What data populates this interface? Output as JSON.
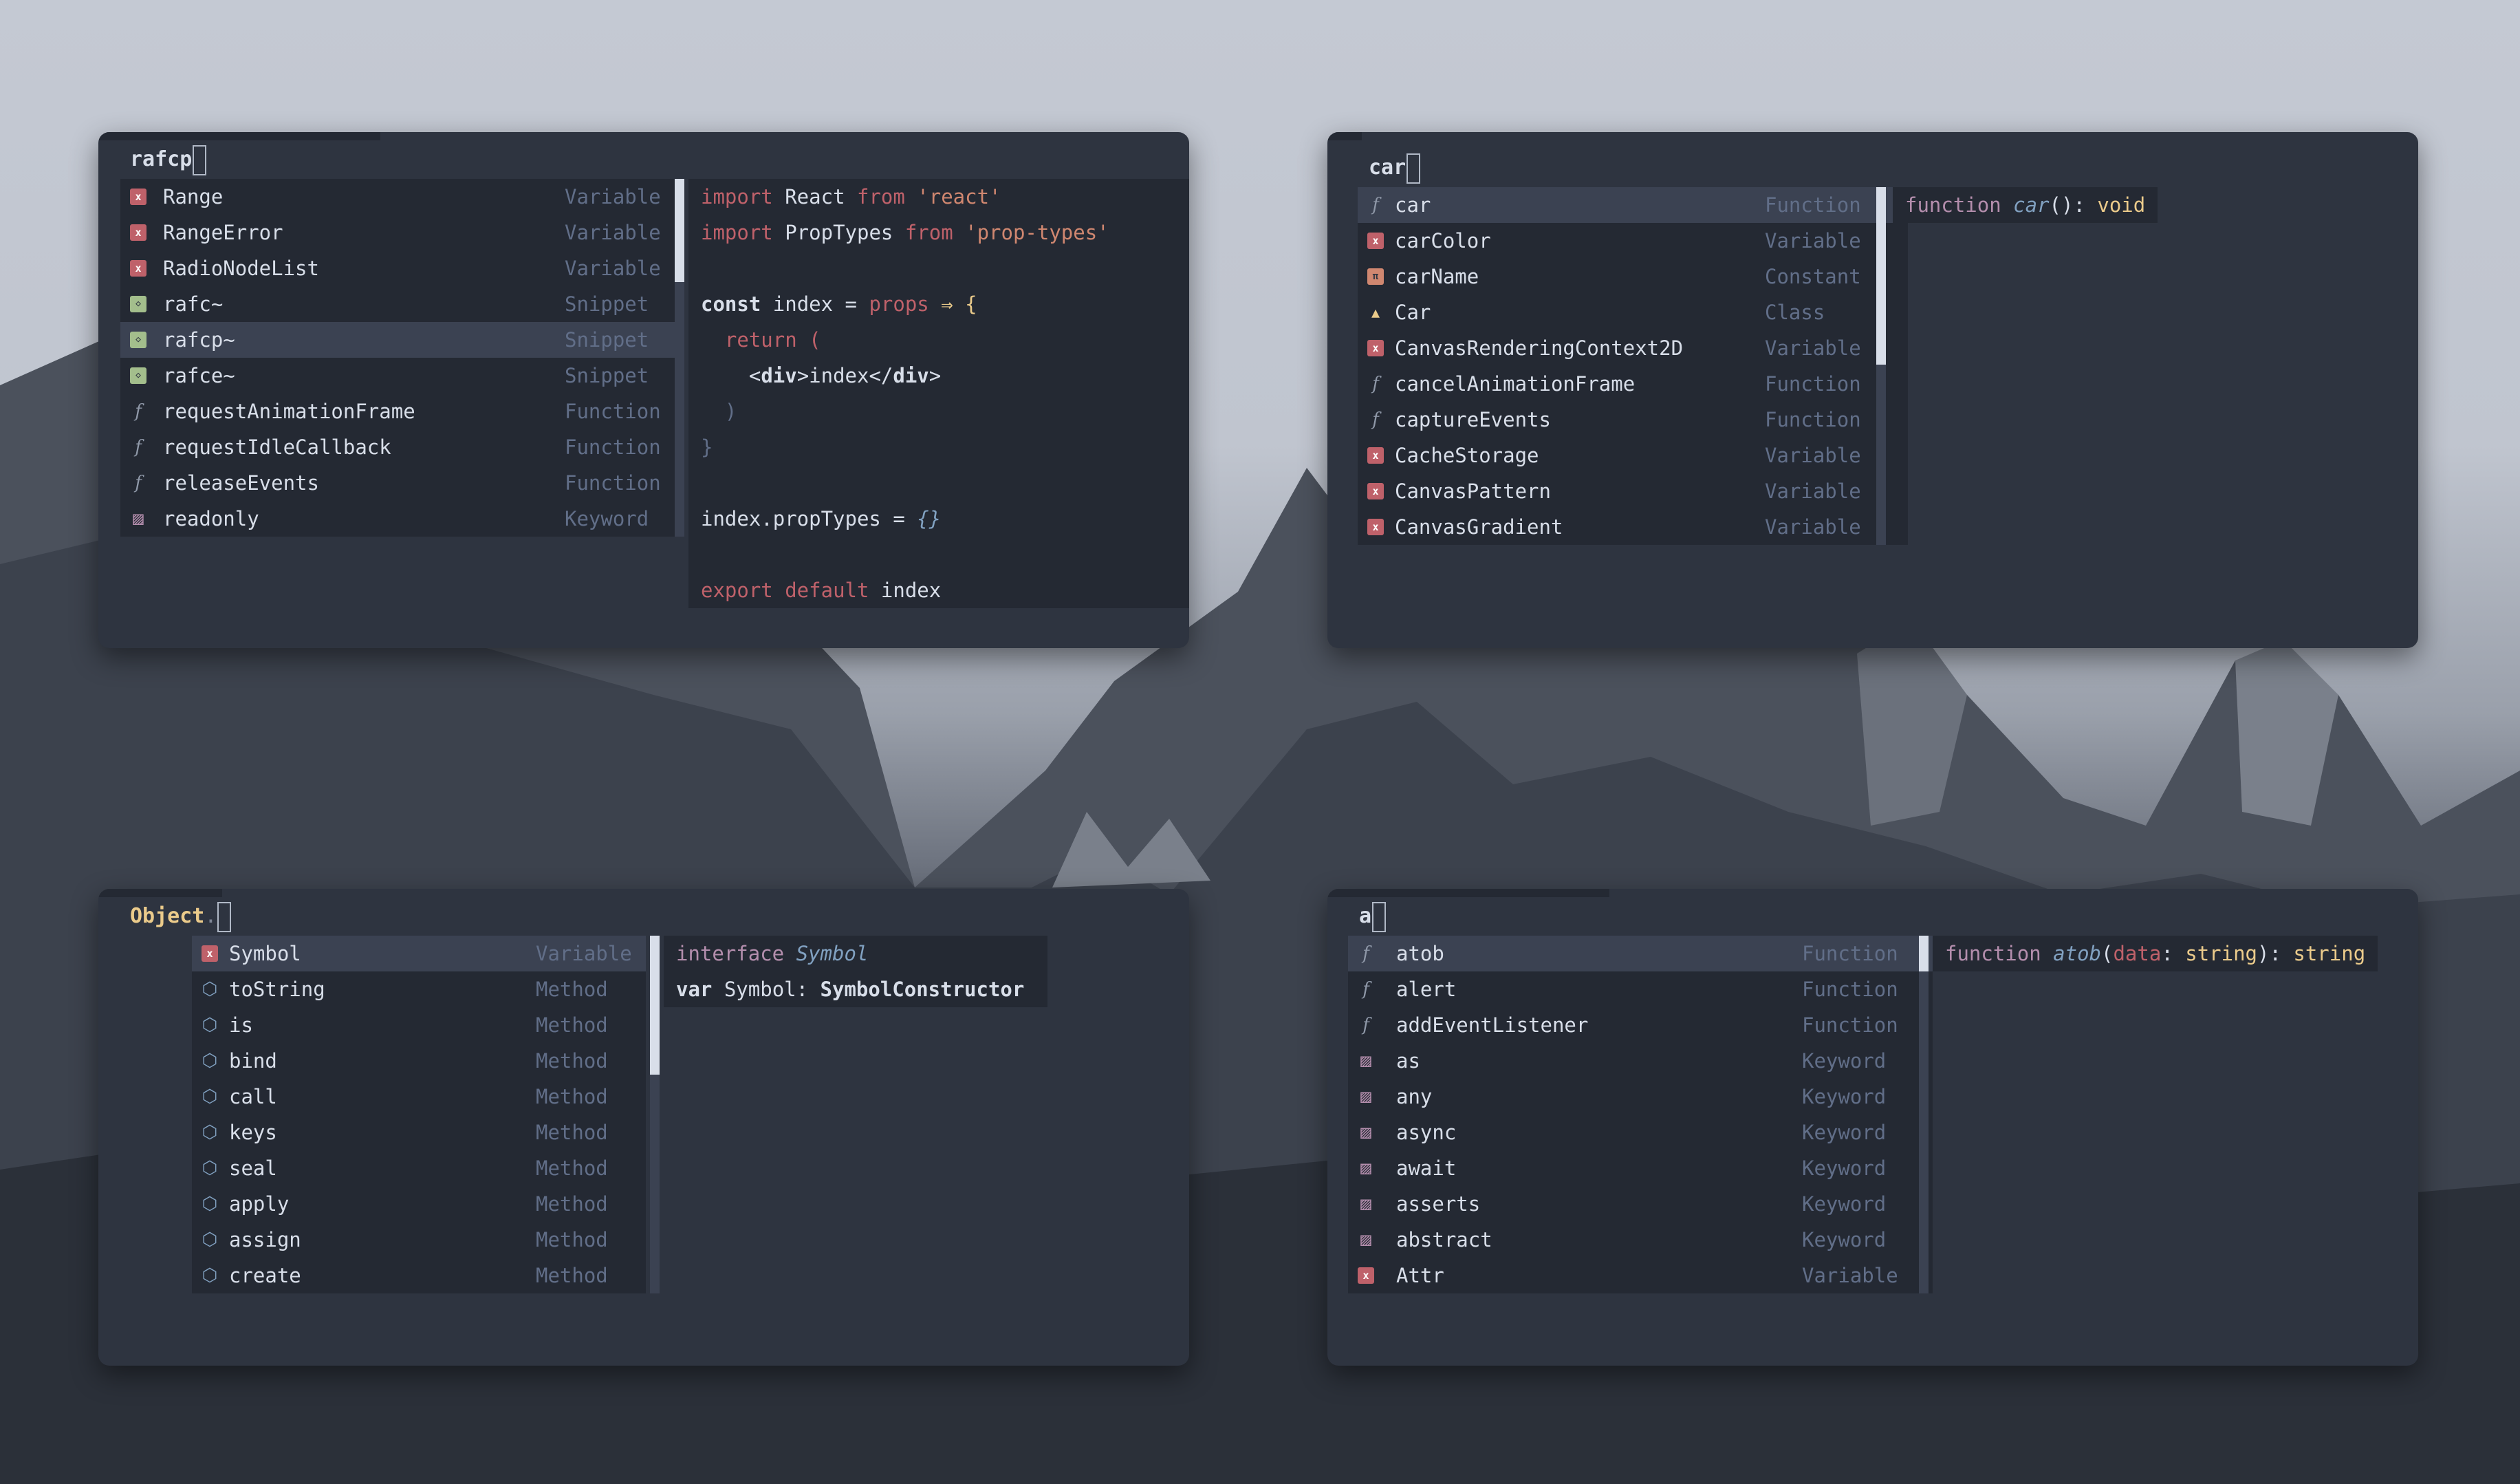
{
  "panels": {
    "p1": {
      "prompt": "rafcp",
      "items": [
        {
          "icon": "variable-icon",
          "label": "Range",
          "kind": "Variable"
        },
        {
          "icon": "variable-icon",
          "label": "RangeError",
          "kind": "Variable"
        },
        {
          "icon": "variable-icon",
          "label": "RadioNodeList",
          "kind": "Variable"
        },
        {
          "icon": "snippet-icon",
          "label": "rafc~",
          "kind": "Snippet"
        },
        {
          "icon": "snippet-icon",
          "label": "rafcp~",
          "kind": "Snippet",
          "selected": true
        },
        {
          "icon": "snippet-icon",
          "label": "rafce~",
          "kind": "Snippet"
        },
        {
          "icon": "function-icon",
          "label": "requestAnimationFrame",
          "kind": "Function"
        },
        {
          "icon": "function-icon",
          "label": "requestIdleCallback",
          "kind": "Function"
        },
        {
          "icon": "function-icon",
          "label": "releaseEvents",
          "kind": "Function"
        },
        {
          "icon": "keyword-icon",
          "label": "readonly",
          "kind": "Keyword"
        }
      ],
      "preview": {
        "l1_import": "import",
        "l1_name": " React ",
        "l1_from": "from",
        "l1_str": " 'react'",
        "l2_import": "import",
        "l2_name": " PropTypes ",
        "l2_from": "from",
        "l2_str": " 'prop-types'",
        "l3_const": "const",
        "l3_rest": " index = ",
        "l3_props": "props",
        "l3_arrow": " ⇒ {",
        "l4": "  return (",
        "l5_open": "    <",
        "l5_div": "div",
        "l5_mid": ">index</",
        "l5_div2": "div",
        "l5_close": ">",
        "l6": "  )",
        "l7": "}",
        "l8_a": "index.propTypes = ",
        "l8_b": "{}",
        "l9_export": "export",
        "l9_default": " default",
        "l9_name": " index"
      }
    },
    "p2": {
      "prompt": "car",
      "items": [
        {
          "icon": "function-icon",
          "label": "car",
          "kind": "Function",
          "selected": true
        },
        {
          "icon": "variable-icon",
          "label": "carColor",
          "kind": "Variable"
        },
        {
          "icon": "constant-icon",
          "label": "carName",
          "kind": "Constant"
        },
        {
          "icon": "class-icon",
          "label": "Car",
          "kind": "Class"
        },
        {
          "icon": "variable-icon",
          "label": "CanvasRenderingContext2D",
          "kind": "Variable"
        },
        {
          "icon": "function-icon",
          "label": "cancelAnimationFrame",
          "kind": "Function"
        },
        {
          "icon": "function-icon",
          "label": "captureEvents",
          "kind": "Function"
        },
        {
          "icon": "variable-icon",
          "label": "CacheStorage",
          "kind": "Variable"
        },
        {
          "icon": "variable-icon",
          "label": "CanvasPattern",
          "kind": "Variable"
        },
        {
          "icon": "variable-icon",
          "label": "CanvasGradient",
          "kind": "Variable"
        }
      ],
      "signature": {
        "kw": "function",
        "name": " car",
        "rest": "(): ",
        "ret": "void"
      }
    },
    "p3": {
      "prompt": "Object",
      "dot": ".",
      "items": [
        {
          "icon": "variable-icon",
          "label": "Symbol",
          "kind": "Variable",
          "selected": true
        },
        {
          "icon": "method-icon",
          "label": "toString",
          "kind": "Method"
        },
        {
          "icon": "method-icon",
          "label": "is",
          "kind": "Method"
        },
        {
          "icon": "method-icon",
          "label": "bind",
          "kind": "Method"
        },
        {
          "icon": "method-icon",
          "label": "call",
          "kind": "Method"
        },
        {
          "icon": "method-icon",
          "label": "keys",
          "kind": "Method"
        },
        {
          "icon": "method-icon",
          "label": "seal",
          "kind": "Method"
        },
        {
          "icon": "method-icon",
          "label": "apply",
          "kind": "Method"
        },
        {
          "icon": "method-icon",
          "label": "assign",
          "kind": "Method"
        },
        {
          "icon": "method-icon",
          "label": "create",
          "kind": "Method"
        }
      ],
      "doc": {
        "l1_kw": "interface",
        "l1_name": " Symbol",
        "l2_kw": "var",
        "l2_rest": " Symbol: ",
        "l2_type": "SymbolConstructor"
      }
    },
    "p4": {
      "prompt": "a",
      "items": [
        {
          "icon": "function-icon",
          "label": "atob",
          "kind": "Function",
          "selected": true
        },
        {
          "icon": "function-icon",
          "label": "alert",
          "kind": "Function"
        },
        {
          "icon": "function-icon",
          "label": "addEventListener",
          "kind": "Function"
        },
        {
          "icon": "keyword-icon",
          "label": "as",
          "kind": "Keyword"
        },
        {
          "icon": "keyword-icon",
          "label": "any",
          "kind": "Keyword"
        },
        {
          "icon": "keyword-icon",
          "label": "async",
          "kind": "Keyword"
        },
        {
          "icon": "keyword-icon",
          "label": "await",
          "kind": "Keyword"
        },
        {
          "icon": "keyword-icon",
          "label": "asserts",
          "kind": "Keyword"
        },
        {
          "icon": "keyword-icon",
          "label": "abstract",
          "kind": "Keyword"
        },
        {
          "icon": "variable-icon",
          "label": "Attr",
          "kind": "Variable"
        }
      ],
      "signature": {
        "kw": "function",
        "name": " atob",
        "p_open": "(",
        "param": "data",
        "colon": ": ",
        "ptype": "string",
        "p_close": "): ",
        "ret": "string"
      }
    }
  },
  "colors": {
    "bg": "#2e3440",
    "menu": "#242933",
    "selected": "#3b4252",
    "variable": "#bf616a",
    "snippet": "#a3be8c",
    "constant": "#d08770",
    "keyword": "#b48ead",
    "method": "#81a1c1"
  }
}
